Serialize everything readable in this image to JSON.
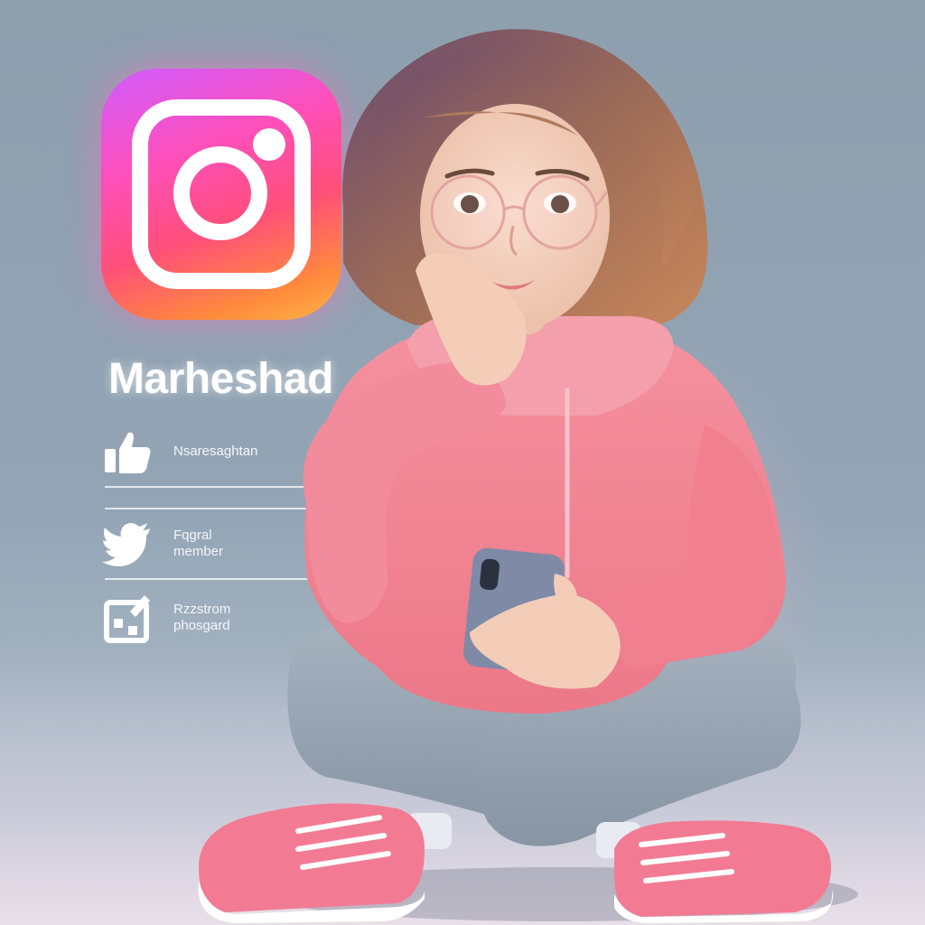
{
  "brand": {
    "name": "Marheshad",
    "logo_icon": "instagram-logo-icon",
    "logo_gradient": [
      "#d05cff",
      "#ff4fb8",
      "#ff8a3c"
    ]
  },
  "menu": {
    "items": [
      {
        "icon": "thumbs-up-icon",
        "label": "Nsaresaghtan"
      },
      {
        "icon": "twitter-bird-icon",
        "label": "Fqgral\nmember"
      },
      {
        "icon": "photo-edit-icon",
        "label": "Rzzstrom\nphosgard"
      }
    ]
  },
  "colors": {
    "hoodie": "#f48a9a",
    "pants": "#9aa7b4",
    "sneakers": "#f27b93",
    "background": "#93a5b5"
  }
}
